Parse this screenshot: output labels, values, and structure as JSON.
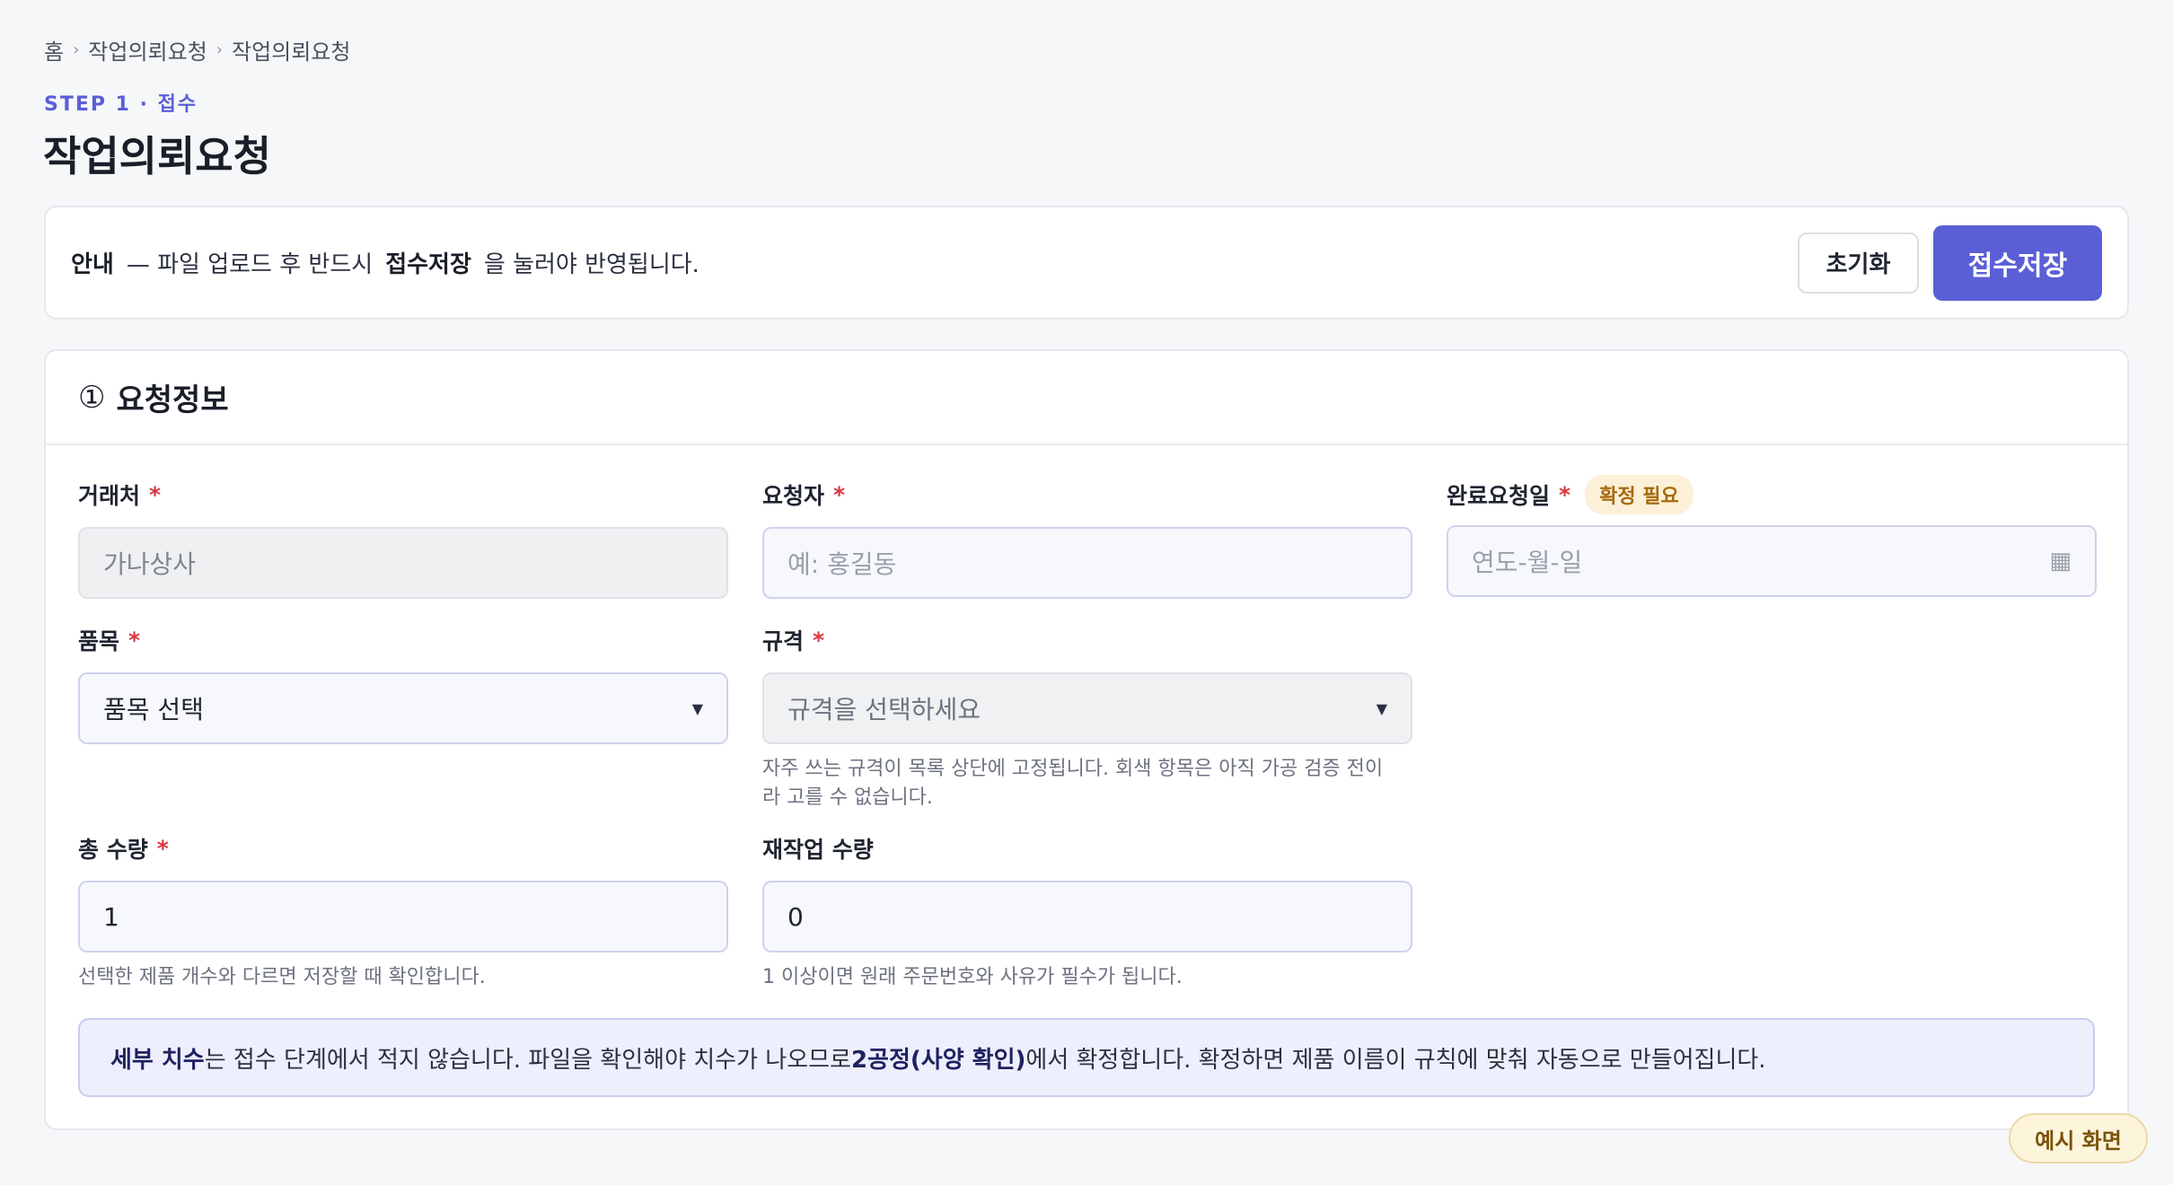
{
  "breadcrumb": {
    "items": [
      "홈",
      "작업의뢰요청",
      "작업의뢰요청"
    ],
    "separator": "›"
  },
  "header": {
    "step_label": "STEP 1 · 접수",
    "title": "작업의뢰요청"
  },
  "notice": {
    "prefix": "안내",
    "text_before": "— 파일 업로드 후 반드시",
    "emphasis": "접수저장",
    "text_after": "을 눌러야 반영됩니다.",
    "reset_label": "초기화",
    "save_label": "접수저장"
  },
  "section": {
    "number": "①",
    "title": "요청정보"
  },
  "fields": {
    "client": {
      "label": "거래처",
      "required_mark": "*",
      "value": "가나상사"
    },
    "requester": {
      "label": "요청자",
      "required_mark": "*",
      "placeholder": "예: 홍길동"
    },
    "due_date": {
      "label": "완료요청일",
      "required_mark": "*",
      "badge": "확정 필요",
      "placeholder": "연도-월-일",
      "icon": "calendar-icon"
    },
    "item": {
      "label": "품목",
      "required_mark": "*",
      "value": "품목 선택",
      "caret": "▼"
    },
    "spec": {
      "label": "규격",
      "required_mark": "*",
      "value": "규격을 선택하세요",
      "caret": "▼",
      "help": "자주 쓰는 규격이 목록 상단에 고정됩니다. 회색 항목은 아직 가공 검증 전이라 고를 수 없습니다."
    },
    "total_qty": {
      "label": "총 수량",
      "required_mark": "*",
      "value": "1",
      "help": "선택한 제품 개수와 다르면 저장할 때 확인합니다."
    },
    "rework_qty": {
      "label": "재작업 수량",
      "value": "0",
      "help": "1 이상이면 원래 주문번호와 사유가 필수가 됩니다."
    }
  },
  "info": {
    "part1": "세부 치수",
    "part2": "는 접수 단계에서 적지 않습니다. 파일을 확인해야 치수가 나오므로 ",
    "part3": "2공정(사양 확인)",
    "part4": "에서 확정합니다. 확정하면 제품 이름이 규칙에 맞춰 자동으로 만들어집니다."
  },
  "example_badge": "예시 화면",
  "colors": {
    "accent": "#5b5fd6",
    "required": "#d9363e",
    "badge_bg": "#fdf0d9",
    "info_bg": "#eeeffc"
  }
}
